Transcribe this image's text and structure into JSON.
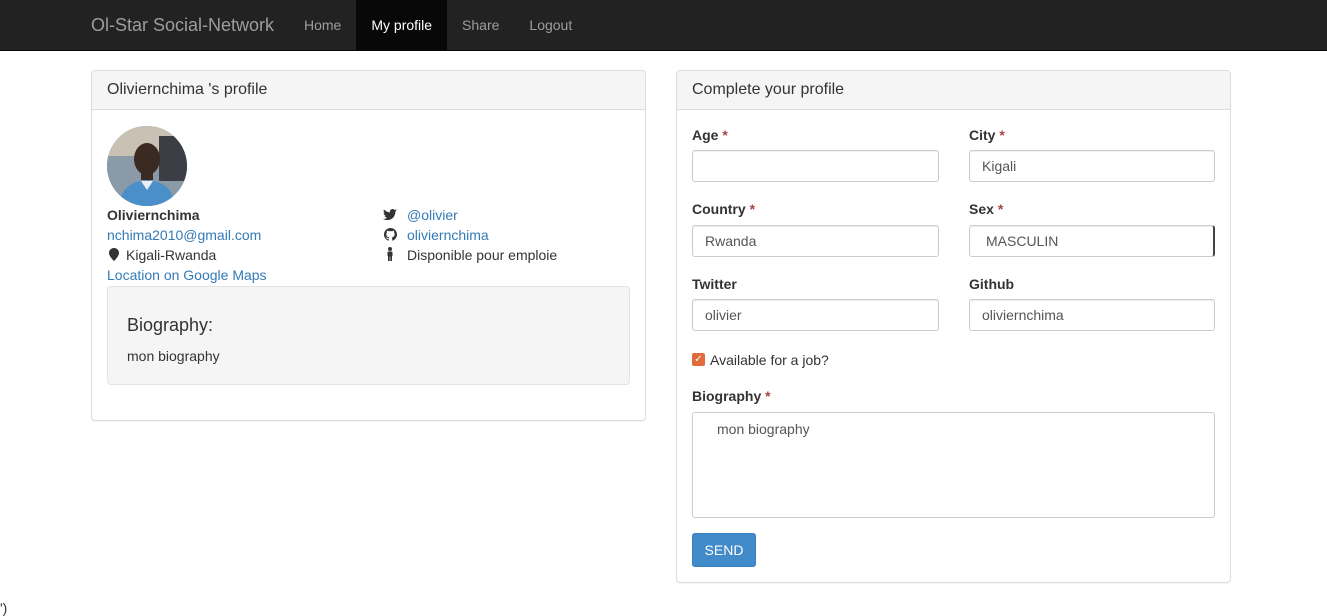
{
  "navbar": {
    "brand": "Ol-Star Social-Network",
    "items": [
      "Home",
      "My profile",
      "Share",
      "Logout"
    ],
    "active": "My profile"
  },
  "profile": {
    "heading": "Oliviernchima 's profile",
    "name": "Oliviernchima",
    "email": "nchima2010@gmail.com",
    "location": "Kigali-Rwanda",
    "maps_link": "Location on Google Maps",
    "twitter": "@olivier",
    "github": "oliviernchima",
    "job_status": "Disponible pour emploie",
    "bio_title": "Biography:",
    "bio_text": "mon biography"
  },
  "form": {
    "heading": "Complete your profile",
    "required_mark": "*",
    "age_label": "Age",
    "age_value": "",
    "city_label": "City",
    "city_value": "Kigali",
    "country_label": "Country",
    "country_value": "Rwanda",
    "sex_label": "Sex",
    "sex_value": "MASCULIN",
    "twitter_label": "Twitter",
    "twitter_value": "olivier",
    "github_label": "Github",
    "github_value": "oliviernchima",
    "job_checkbox_label": "Available for a job?",
    "job_checked": true,
    "biography_label": "Biography",
    "biography_value": "mon biography",
    "send_label": "SEND"
  },
  "stray_text": "')",
  "colors": {
    "navbar_bg": "#222222",
    "link": "#337ab7",
    "button": "#428bca",
    "checkbox": "#e06c3c",
    "required": "#a94442"
  }
}
